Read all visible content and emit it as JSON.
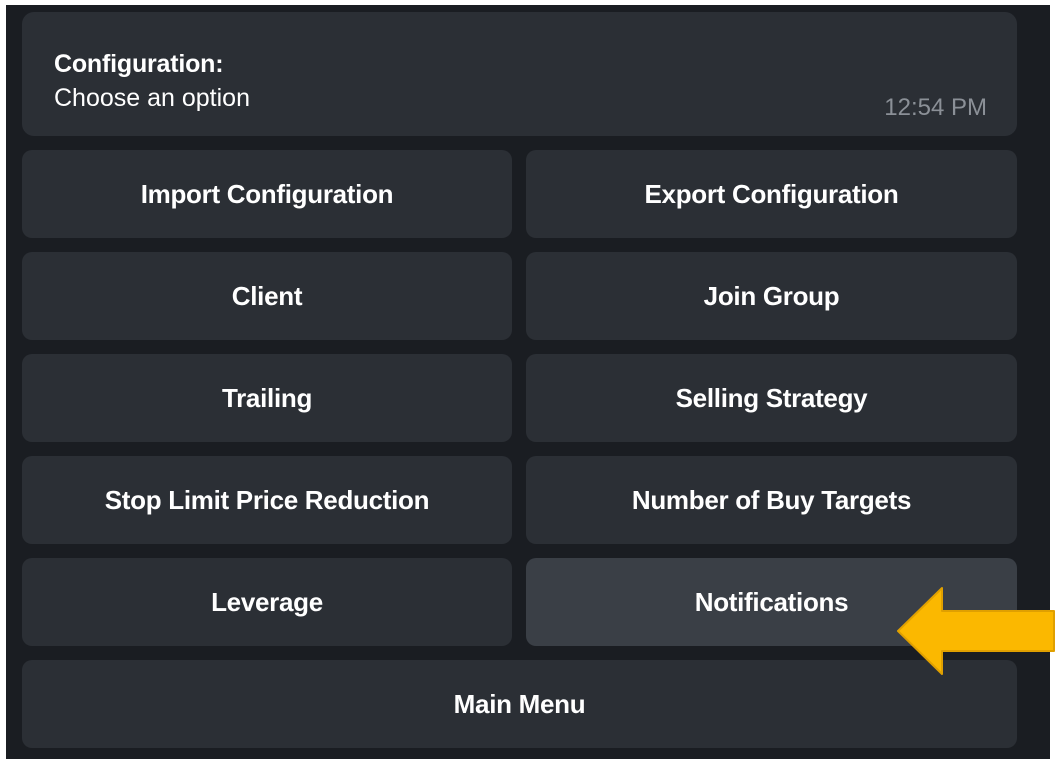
{
  "message": {
    "title": "Configuration:",
    "body": "Choose an option",
    "time": "12:54 PM"
  },
  "keyboard": {
    "buttons": [
      "Import Configuration",
      "Export Configuration",
      "Client",
      "Join Group",
      "Trailing",
      "Selling Strategy",
      "Stop Limit Price Reduction",
      "Number of Buy Targets",
      "Leverage",
      "Notifications",
      "Main Menu"
    ]
  },
  "annotation": {
    "arrow_color": "#fbb800",
    "arrow_outline": "#e0a000",
    "icon": "left-arrow-icon"
  },
  "colors": {
    "background": "#1a1d22",
    "button": "#2b2f35",
    "button_active": "#3a3f46",
    "time_text": "#8b9097"
  }
}
